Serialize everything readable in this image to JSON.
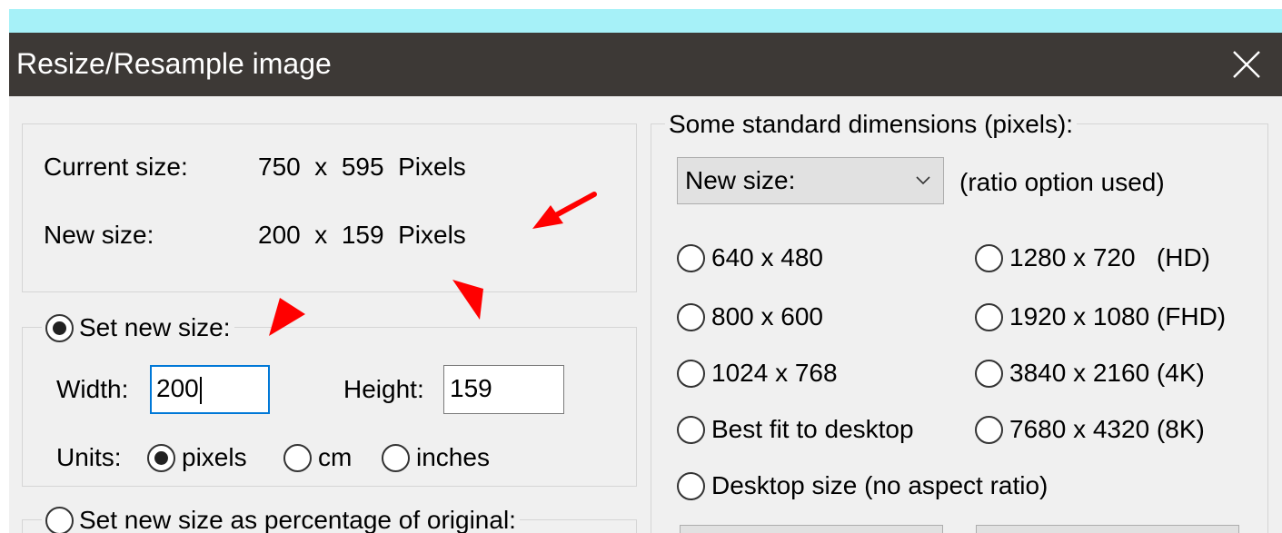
{
  "window": {
    "title": "Resize/Resample image"
  },
  "size_info": {
    "current_label": "Current size:",
    "current_value": "750  x  595  Pixels",
    "new_label": "New size:",
    "new_value": "200  x  159  Pixels"
  },
  "set_size": {
    "label": "Set new size:",
    "selected": true,
    "width_label": "Width:",
    "width_value": "200",
    "height_label": "Height:",
    "height_value": "159",
    "units_label": "Units:",
    "units": [
      "pixels",
      "cm",
      "inches"
    ],
    "selected_unit": "pixels"
  },
  "percentage": {
    "label": "Set new size as percentage of original:",
    "selected": false
  },
  "standard": {
    "title": "Some standard dimensions (pixels):",
    "dropdown_value": "New size:",
    "ratio_note": "(ratio option used)",
    "options_left": [
      "640 x 480",
      "800 x 600",
      "1024 x 768",
      "Best fit to desktop"
    ],
    "options_right": [
      "1280 x 720   (HD)",
      "1920 x 1080 (FHD)",
      "3840 x 2160 (4K)",
      "7680 x 4320 (8K)"
    ],
    "option_full": "Desktop size (no aspect ratio)"
  },
  "colors": {
    "titlebar": "#3d3936",
    "focus": "#0078d7",
    "annotation_arrow": "#ff0000",
    "top_band": "#a6f1f8"
  },
  "icons": {
    "close": "close-icon",
    "dropdown": "chevron-down-icon"
  }
}
